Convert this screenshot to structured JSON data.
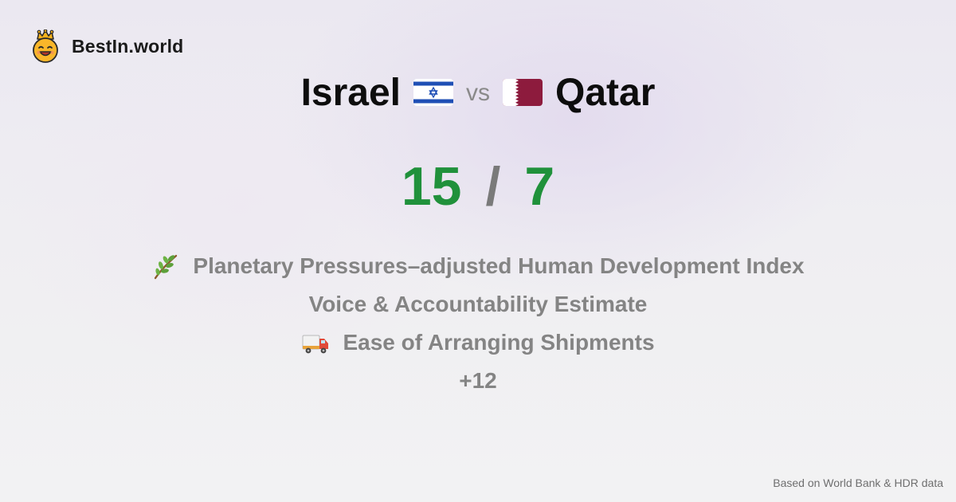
{
  "brand": {
    "name": "BestIn.world",
    "logo_icon": "crowned-smiley-icon"
  },
  "comparison": {
    "left_country": "Israel",
    "left_flag_icon": "israel-flag-icon",
    "vs_label": "vs",
    "right_country": "Qatar",
    "right_flag_icon": "qatar-flag-icon"
  },
  "score": {
    "left": "15",
    "separator": "/",
    "right": "7"
  },
  "metrics": [
    {
      "icon": "herb-branch-icon",
      "label": "Planetary Pressures–adjusted Human Development Index"
    },
    {
      "icon": "",
      "label": "Voice & Accountability Estimate"
    },
    {
      "icon": "delivery-truck-icon",
      "label": "Ease of Arranging Shipments"
    }
  ],
  "more_label": "+12",
  "footer": {
    "source": "Based on World Bank & HDR data"
  },
  "colors": {
    "score_green": "#20913b",
    "muted_text": "#848484",
    "israel_blue": "#1f4fb5",
    "qatar_maroon": "#8d1b3d"
  }
}
